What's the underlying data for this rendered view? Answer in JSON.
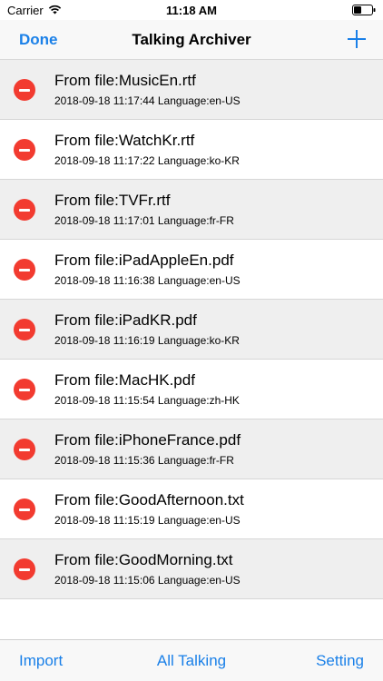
{
  "status_bar": {
    "carrier": "Carrier",
    "time": "11:18 AM",
    "icons": [
      "wifi-icon",
      "battery-icon"
    ]
  },
  "nav": {
    "done_label": "Done",
    "title": "Talking Archiver",
    "add_icon": "plus-icon"
  },
  "accent_color": "#1a80e8",
  "delete_color": "#f23b30",
  "items": [
    {
      "title": "From file:MusicEn.rtf",
      "subtitle": "2018-09-18 11:17:44 Language:en-US"
    },
    {
      "title": "From file:WatchKr.rtf",
      "subtitle": "2018-09-18 11:17:22 Language:ko-KR"
    },
    {
      "title": "From file:TVFr.rtf",
      "subtitle": "2018-09-18 11:17:01 Language:fr-FR"
    },
    {
      "title": "From file:iPadAppleEn.pdf",
      "subtitle": "2018-09-18 11:16:38 Language:en-US"
    },
    {
      "title": "From file:iPadKR.pdf",
      "subtitle": "2018-09-18 11:16:19 Language:ko-KR"
    },
    {
      "title": "From file:MacHK.pdf",
      "subtitle": "2018-09-18 11:15:54 Language:zh-HK"
    },
    {
      "title": "From file:iPhoneFrance.pdf",
      "subtitle": "2018-09-18 11:15:36 Language:fr-FR"
    },
    {
      "title": "From file:GoodAfternoon.txt",
      "subtitle": "2018-09-18 11:15:19 Language:en-US"
    },
    {
      "title": "From file:GoodMorning.txt",
      "subtitle": "2018-09-18 11:15:06 Language:en-US"
    }
  ],
  "tab_bar": {
    "import_label": "Import",
    "all_label": "All Talking",
    "setting_label": "Setting"
  }
}
